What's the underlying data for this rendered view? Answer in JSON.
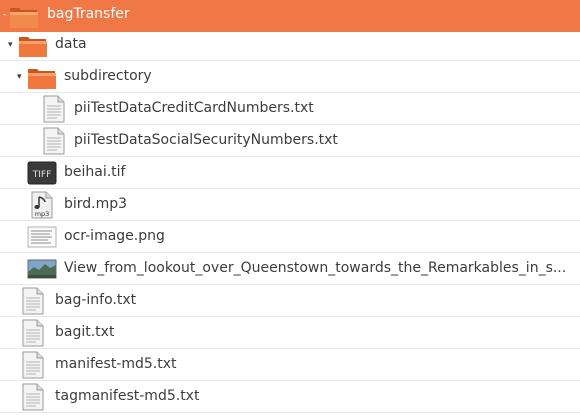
{
  "tree": {
    "root": {
      "label": "bagTransfer",
      "icon": "folder-icon",
      "expander": "-"
    },
    "data_folder": {
      "label": "data",
      "icon": "folder-icon",
      "expander": "▾"
    },
    "subdirectory": {
      "label": "subdirectory",
      "icon": "folder-icon",
      "expander": "▾"
    },
    "items": [
      {
        "label": "piiTestDataCreditCardNumbers.txt",
        "icon": "text-file-icon"
      },
      {
        "label": "piiTestDataSocialSecurityNumbers.txt",
        "icon": "text-file-icon"
      },
      {
        "label": "beihai.tif",
        "icon": "tiff-image-icon",
        "badge": "TIFF"
      },
      {
        "label": "bird.mp3",
        "icon": "audio-file-icon",
        "badge": "mp3"
      },
      {
        "label": "ocr-image.png",
        "icon": "png-thumbnail-icon"
      },
      {
        "label": "View_from_lookout_over_Queenstown_towards_the_Remarkables_in_s...",
        "icon": "landscape-thumbnail-icon"
      },
      {
        "label": "bag-info.txt",
        "icon": "text-file-icon"
      },
      {
        "label": "bagit.txt",
        "icon": "text-file-icon"
      },
      {
        "label": "manifest-md5.txt",
        "icon": "text-file-icon"
      },
      {
        "label": "tagmanifest-md5.txt",
        "icon": "text-file-icon"
      }
    ]
  },
  "colors": {
    "selection": "#f07746",
    "folder": "#e8733c",
    "text": "#3c3c3c"
  }
}
